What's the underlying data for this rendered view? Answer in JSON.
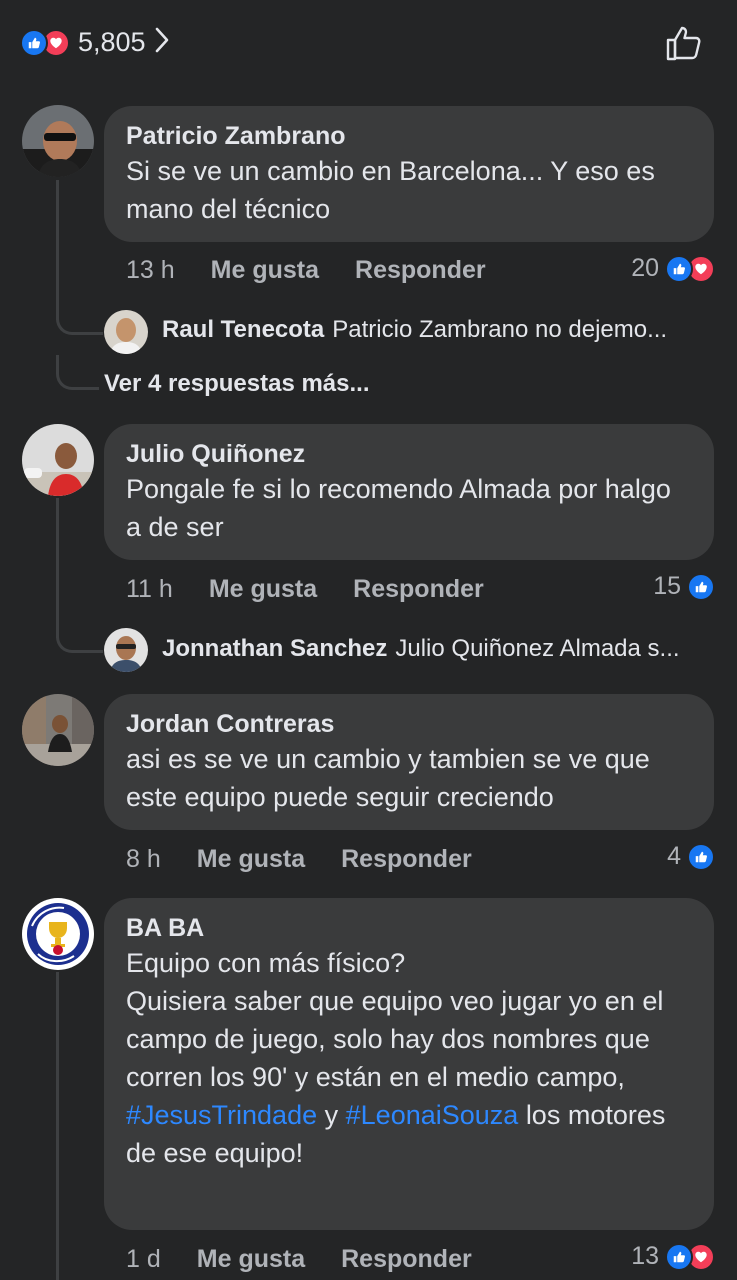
{
  "header": {
    "reaction_count": "5,805"
  },
  "colors": {
    "background": "#242526",
    "bubble": "#3a3b3c",
    "like": "#1877f2",
    "love": "#f33e58",
    "hashtag": "#2d88ff"
  },
  "comments": [
    {
      "author": "Patricio Zambrano",
      "text": "Si se ve un cambio en Barcelona... Y eso es mano del técnico",
      "time": "13 h",
      "like_label": "Me gusta",
      "reply_label": "Responder",
      "reactions": "20",
      "reaction_icons": [
        "like-icon",
        "love-icon"
      ],
      "reply_preview": {
        "author": "Raul Tenecota",
        "text": "Patricio Zambrano no dejemo..."
      },
      "more_replies": "Ver 4 respuestas más..."
    },
    {
      "author": "Julio Quiñonez",
      "text": "Pongale fe si lo recomendo Almada por halgo a de ser",
      "time": "11 h",
      "like_label": "Me gusta",
      "reply_label": "Responder",
      "reactions": "15",
      "reaction_icons": [
        "like-icon"
      ],
      "reply_preview": {
        "author": "Jonnathan Sanchez",
        "text": "Julio Quiñonez Almada s..."
      }
    },
    {
      "author": "Jordan Contreras",
      "text": "asi es se ve un cambio y tambien se ve que este equipo puede seguir creciendo",
      "time": "8 h",
      "like_label": "Me gusta",
      "reply_label": "Responder",
      "reactions": "4",
      "reaction_icons": [
        "like-icon"
      ]
    },
    {
      "author": "BA BA",
      "text_lines": [
        "Equipo con más físico?",
        "Quisiera saber que equipo veo jugar yo en el campo de juego, solo hay dos nombres que corren los 90' y están en el medio campo,"
      ],
      "hashtag1": "#JesusTrindade",
      "join": "y",
      "hashtag2": "#LeonaiSouza",
      "text_end": "los motores de ese equipo!",
      "avatar_text": "TORNEO INFANTIL FUTBOL CHAMPIONS KIDS",
      "time": "1 d",
      "like_label": "Me gusta",
      "reply_label": "Responder",
      "reactions": "13",
      "reaction_icons": [
        "like-icon",
        "love-icon"
      ]
    }
  ]
}
